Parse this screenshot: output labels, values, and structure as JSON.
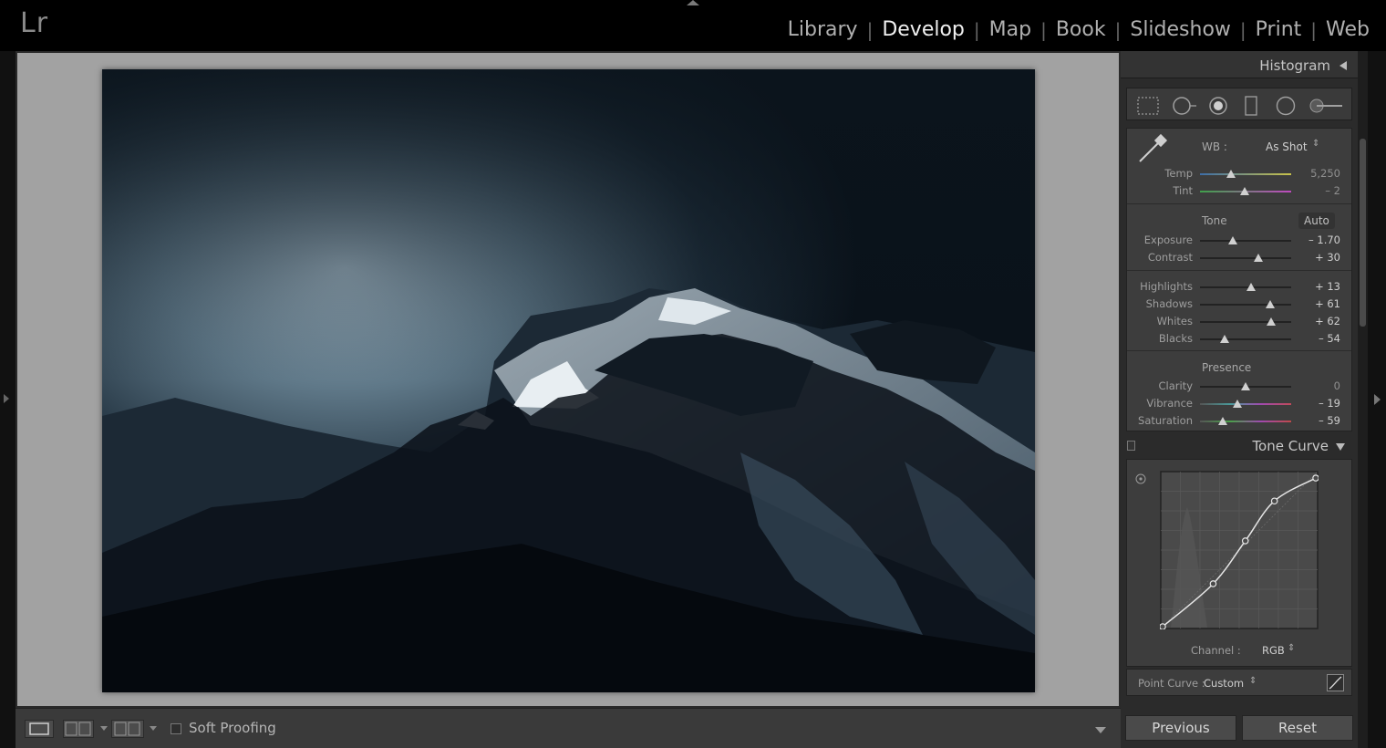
{
  "app": {
    "logo": "Lr"
  },
  "modules": [
    {
      "label": "Library",
      "active": false
    },
    {
      "label": "Develop",
      "active": true
    },
    {
      "label": "Map",
      "active": false
    },
    {
      "label": "Book",
      "active": false
    },
    {
      "label": "Slideshow",
      "active": false
    },
    {
      "label": "Print",
      "active": false
    },
    {
      "label": "Web",
      "active": false
    }
  ],
  "toolbar": {
    "view_icon": "loupe-view-icon",
    "before_after_icons": [
      "before-after-left-right-icon",
      "before-after-top-bottom-icon"
    ],
    "soft_proofing_label": "Soft Proofing"
  },
  "panel": {
    "histogram_title": "Histogram",
    "tools": [
      "crop-overlay-icon",
      "spot-removal-icon",
      "red-eye-icon",
      "graduated-filter-icon",
      "radial-filter-icon",
      "adjustment-brush-icon"
    ],
    "wb": {
      "label": "WB :",
      "value": "As Shot",
      "eyedropper_icon": "eyedropper-icon"
    },
    "tone_title": "Tone",
    "auto_label": "Auto",
    "presence_title": "Presence",
    "sliders": {
      "temp": {
        "label": "Temp",
        "value": "5,250",
        "position": 0.34
      },
      "tint": {
        "label": "Tint",
        "value": "– 2",
        "position": 0.49
      },
      "exposure": {
        "label": "Exposure",
        "value": "– 1.70",
        "position": 0.36
      },
      "contrast": {
        "label": "Contrast",
        "value": "+ 30",
        "position": 0.64
      },
      "highlights": {
        "label": "Highlights",
        "value": "+ 13",
        "position": 0.56
      },
      "shadows": {
        "label": "Shadows",
        "value": "+ 61",
        "position": 0.77
      },
      "whites": {
        "label": "Whites",
        "value": "+ 62",
        "position": 0.78
      },
      "blacks": {
        "label": "Blacks",
        "value": "– 54",
        "position": 0.27
      },
      "clarity": {
        "label": "Clarity",
        "value": "0",
        "position": 0.5
      },
      "vibrance": {
        "label": "Vibrance",
        "value": "– 19",
        "position": 0.41
      },
      "saturation": {
        "label": "Saturation",
        "value": "– 59",
        "position": 0.25
      }
    },
    "tone_curve": {
      "title": "Tone Curve",
      "channel_label": "Channel :",
      "channel_value": "RGB",
      "point_curve_label": "Point Curve :",
      "point_curve_value": "Custom",
      "points": [
        [
          0,
          0
        ],
        [
          0.33,
          0.28
        ],
        [
          0.54,
          0.56
        ],
        [
          0.73,
          0.82
        ],
        [
          1,
          0.97
        ]
      ]
    },
    "previous_label": "Previous",
    "reset_label": "Reset"
  }
}
